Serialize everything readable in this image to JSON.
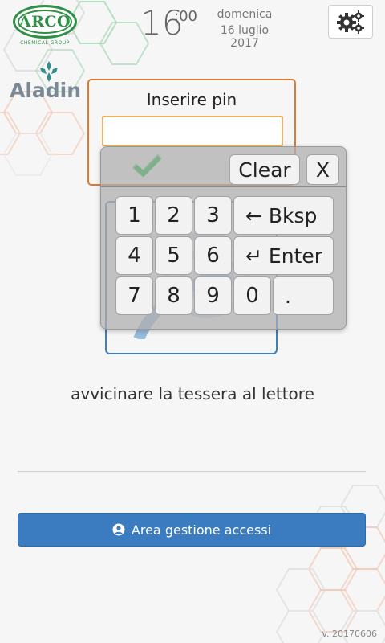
{
  "header": {
    "brand_name": "ARCO",
    "brand_subtitle": "CHEMICAL GROUP",
    "time_hours": "16",
    "time_minutes": ":00",
    "day_name": "domenica",
    "date": "16 luglio 2017",
    "settings_icon": "gears-icon"
  },
  "aladin": {
    "logo_text": "Aladin"
  },
  "pin_dialog": {
    "title": "Inserire pin",
    "input_value": ""
  },
  "keyboard": {
    "clear_label": "Clear",
    "close_label": "X",
    "keys": [
      "1",
      "2",
      "3",
      "4",
      "5",
      "6",
      "7",
      "8",
      "9",
      "0",
      "."
    ],
    "backspace_label": "← Bksp",
    "enter_label": "↵ Enter"
  },
  "reader_message": "avvicinare la tessera al lettore",
  "access_button": {
    "label": "Area gestione accessi",
    "icon": "user-circle-icon"
  },
  "version": "v. 20170606",
  "colors": {
    "brand_green": "#2f8f45",
    "accent_orange": "#e07a2e",
    "primary_blue": "#3a7cbf"
  }
}
